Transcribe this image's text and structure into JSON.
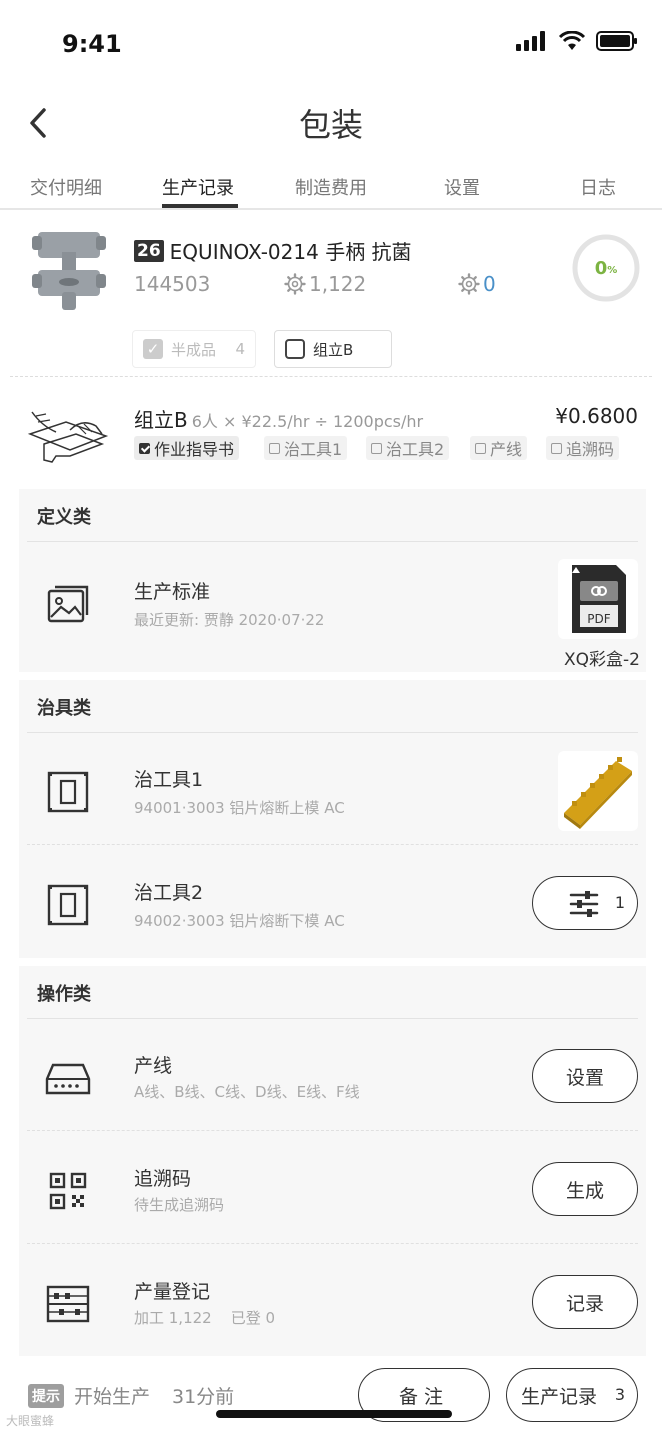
{
  "status_bar": {
    "time": "9:41"
  },
  "nav": {
    "title": "包装"
  },
  "tabs": [
    {
      "label": "交付明细"
    },
    {
      "label": "生产记录",
      "active": true
    },
    {
      "label": "制造费用"
    },
    {
      "label": "设置"
    },
    {
      "label": "日志"
    }
  ],
  "product": {
    "badge": "26",
    "name": "EQUINOX-0214 手柄 抗菌",
    "code": "144503",
    "quantity": "1,122",
    "quantity_second": "0",
    "progress": "0",
    "progress_unit": "%",
    "chips": [
      {
        "label": "半成品",
        "count": "4",
        "checked": true,
        "disabled": true
      },
      {
        "label": "组立B",
        "checked": false
      }
    ]
  },
  "assembly": {
    "title": "组立B",
    "detail": "6人 × ¥22.5/hr ÷ 1200pcs/hr",
    "price": "¥0.6800",
    "tags": [
      {
        "label": "作业指导书",
        "checked": true
      },
      {
        "label": "治工具1",
        "checked": false
      },
      {
        "label": "治工具2",
        "checked": false
      },
      {
        "label": "产线",
        "checked": false
      },
      {
        "label": "追溯码",
        "checked": false
      }
    ]
  },
  "sections": {
    "definition": {
      "title": "定义类",
      "item": {
        "title": "生产标准",
        "subtitle": "最近更新: 贾静 2020·07·22",
        "attachment_label": "XQ彩盒-2",
        "attachment_type": "PDF"
      }
    },
    "fixtures": {
      "title": "治具类",
      "items": [
        {
          "title": "治工具1",
          "subtitle": "94001·3003 铝片熔断上模 AC"
        },
        {
          "title": "治工具2",
          "subtitle": "94002·3003 铝片熔断下模 AC",
          "filter_count": "1"
        }
      ]
    },
    "operations": {
      "title": "操作类",
      "items": [
        {
          "title": "产线",
          "subtitle": "A线、B线、C线、D线、E线、F线",
          "action": "设置",
          "icon": "production-line-icon"
        },
        {
          "title": "追溯码",
          "subtitle": "待生成追溯码",
          "action": "生成",
          "icon": "qr-code-icon"
        },
        {
          "title": "产量登记",
          "subtitle": "加工 1,122    已登 0",
          "action": "记录",
          "icon": "abacus-icon"
        }
      ]
    }
  },
  "bottom": {
    "hint_badge": "提示",
    "hint_text": "开始生产",
    "hint_time": "31分前",
    "note_button": "备注",
    "record_button": "生产记录",
    "record_count": "3"
  },
  "watermark": "大眼蜜蜂",
  "colors": {
    "progress": "#7cb342",
    "link": "#4a90c8"
  }
}
